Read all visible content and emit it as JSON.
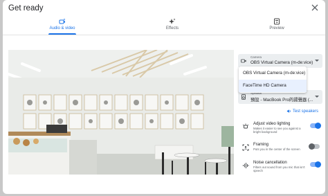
{
  "dialog": {
    "title": "Get ready"
  },
  "tabs": [
    {
      "label": "Audio & video",
      "icon": "camera-sparkle-icon",
      "active": true
    },
    {
      "label": "Effects",
      "icon": "sparkle-icon",
      "active": false
    },
    {
      "label": "Preview",
      "icon": "preview-icon",
      "active": false
    }
  ],
  "camera": {
    "label": "Camera",
    "value": "OBS Virtual Camera (m-de:vice)",
    "icon": "camera-icon",
    "options": [
      "OBS Virtual Camera (m-de:vice)",
      "FaceTime HD Camera"
    ]
  },
  "speaker": {
    "label": "Speaker",
    "value": "預設 - MacBook Pro的揚聲器 (...",
    "icon": "speaker-icon"
  },
  "test_speakers": "Test speakers",
  "settings": [
    {
      "name": "Adjust video lighting",
      "desc": "Makes it easier to see you against a bright background",
      "on": true,
      "icon": "lighting-icon"
    },
    {
      "name": "Framing",
      "desc": "Puts you in the center of the screen",
      "on": false,
      "icon": "framing-icon"
    },
    {
      "name": "Noise cancellation",
      "desc": "Filters out sound from you mic that isn't speech",
      "on": true,
      "icon": "noise-icon"
    }
  ],
  "colors": {
    "accent": "#1a73e8",
    "toggle_track_on": "#8ab4f8"
  }
}
